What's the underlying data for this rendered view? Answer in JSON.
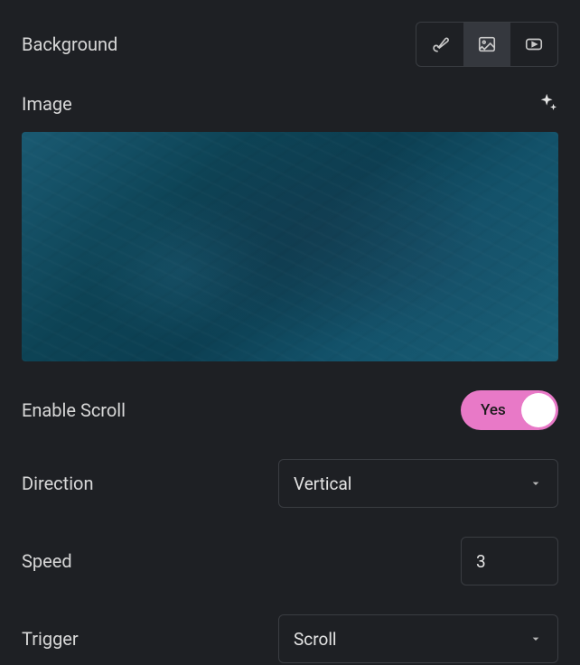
{
  "header": {
    "title": "Background",
    "tabs": {
      "color": "color-tab",
      "image": "image-tab",
      "video": "video-tab",
      "active": "image"
    }
  },
  "image_section": {
    "title": "Image"
  },
  "controls": {
    "enable_scroll": {
      "label": "Enable Scroll",
      "value": "Yes",
      "state": true
    },
    "direction": {
      "label": "Direction",
      "value": "Vertical"
    },
    "speed": {
      "label": "Speed",
      "value": "3"
    },
    "trigger": {
      "label": "Trigger",
      "value": "Scroll"
    }
  }
}
